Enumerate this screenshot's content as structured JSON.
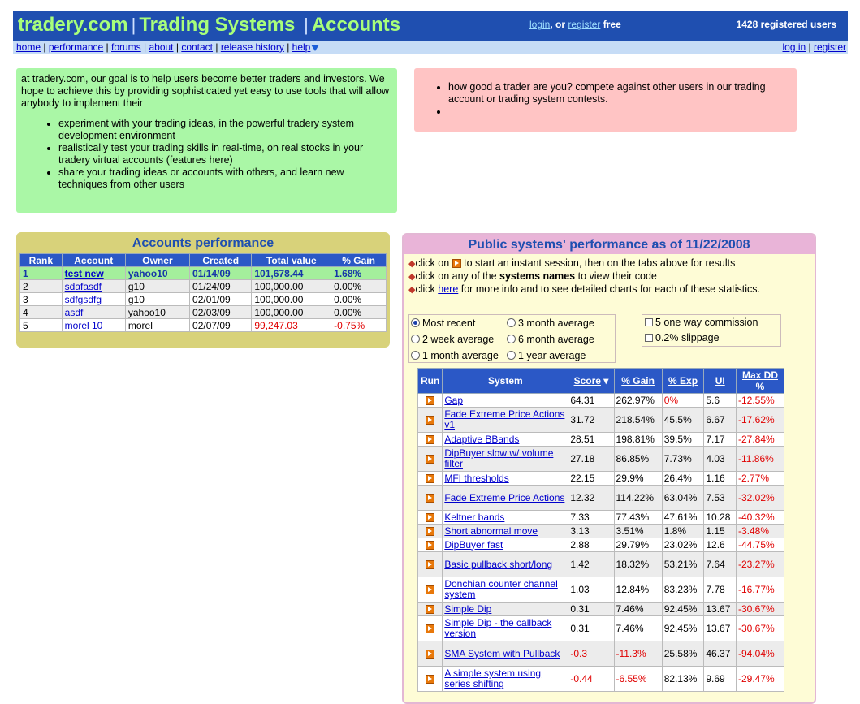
{
  "header": {
    "title_part1": "tradery.com",
    "title_part2": "Trading Systems",
    "title_part3": "Accounts",
    "login_label": "login",
    "or_label": ", or ",
    "register_label": "register",
    "free_label": " free",
    "users_count": "1428 registered users"
  },
  "nav": {
    "items": [
      "home",
      "performance",
      "forums",
      "about",
      "contact",
      "release history",
      "help"
    ],
    "login_label": "log in",
    "register_label": "register"
  },
  "intro": {
    "text": "at tradery.com, our goal is to help users become better traders and investors. We hope to achieve this by providing sophisticated yet easy to use tools that will allow anybody to implement their",
    "bullets": [
      "experiment with your trading ideas, in the powerful tradery system development environment",
      "realistically test your trading skills in real-time, on real stocks in your tradery virtual accounts (features here)",
      "share your trading ideas or accounts with others, and learn new techniques from other users"
    ]
  },
  "contest": {
    "bullets": [
      "how good a trader are you? compete against other users in our trading account or trading system contests.",
      ""
    ]
  },
  "accounts": {
    "title": "Accounts performance",
    "columns": [
      "Rank",
      "Account",
      "Owner",
      "Created",
      "Total value",
      "% Gain"
    ],
    "rows": [
      [
        "1",
        "test new",
        "yahoo10",
        "01/14/09",
        "101,678.44",
        "1.68%"
      ],
      [
        "2",
        "sdafasdf",
        "g10",
        "01/24/09",
        "100,000.00",
        "0.00%"
      ],
      [
        "3",
        "sdfgsdfg",
        "g10",
        "02/01/09",
        "100,000.00",
        "0.00%"
      ],
      [
        "4",
        "asdf",
        "yahoo10",
        "02/03/09",
        "100,000.00",
        "0.00%"
      ],
      [
        "5",
        "morel 10",
        "morel",
        "02/07/09",
        "99,247.03",
        "-0.75%"
      ]
    ]
  },
  "systems": {
    "title": "Public systems' performance as of 11/22/2008",
    "help": {
      "line1_pre": "click on ",
      "line1_post": " to start an instant session, then on the tabs above for results",
      "line2_pre": "click on any of the ",
      "line2_bold": "systems names",
      "line2_post": " to view their code",
      "line3_pre": "click ",
      "line3_link": "here",
      "line3_post": " for more info and to see detailed charts for each of these statistics."
    },
    "averages": [
      "Most recent",
      "3 month average",
      "2 week average",
      "6 month average",
      "1 month average",
      "1 year average"
    ],
    "selected_average": "Most recent",
    "commission_label": "5 one way commission",
    "slippage_label": "0.2% slippage",
    "columns": [
      "Run",
      "System",
      "Score",
      "% Gain",
      "% Exp",
      "UI",
      "Max DD %"
    ],
    "rows": [
      [
        "Gap",
        "64.31",
        "262.97%",
        "0%",
        "5.6",
        "-12.55%"
      ],
      [
        "Fade Extreme Price Actions v1",
        "31.72",
        "218.54%",
        "45.5%",
        "6.67",
        "-17.62%"
      ],
      [
        "Adaptive BBands",
        "28.51",
        "198.81%",
        "39.5%",
        "7.17",
        "-27.84%"
      ],
      [
        "DipBuyer slow w/ volume filter",
        "27.18",
        "86.85%",
        "7.73%",
        "4.03",
        "-11.86%"
      ],
      [
        "MFI thresholds",
        "22.15",
        "29.9%",
        "26.4%",
        "1.16",
        "-2.77%"
      ],
      [
        "Fade Extreme Price Actions",
        "12.32",
        "114.22%",
        "63.04%",
        "7.53",
        "-32.02%"
      ],
      [
        "Keltner bands",
        "7.33",
        "77.43%",
        "47.61%",
        "10.28",
        "-40.32%"
      ],
      [
        "Short abnormal move",
        "3.13",
        "3.51%",
        "1.8%",
        "1.15",
        "-3.48%"
      ],
      [
        "DipBuyer fast",
        "2.88",
        "29.79%",
        "23.02%",
        "12.6",
        "-44.75%"
      ],
      [
        "Basic pullback short/long",
        "1.42",
        "18.32%",
        "53.21%",
        "7.64",
        "-23.27%"
      ],
      [
        "Donchian counter channel system",
        "1.03",
        "12.84%",
        "83.23%",
        "7.78",
        "-16.77%"
      ],
      [
        "Simple Dip",
        "0.31",
        "7.46%",
        "92.45%",
        "13.67",
        "-30.67%"
      ],
      [
        "Simple Dip - the callback version",
        "0.31",
        "7.46%",
        "92.45%",
        "13.67",
        "-30.67%"
      ],
      [
        "SMA System with Pullback",
        "-0.3",
        "-11.3%",
        "25.58%",
        "46.37",
        "-94.04%"
      ],
      [
        "A simple system using series shifting",
        "-0.44",
        "-6.55%",
        "82.13%",
        "9.69",
        "-29.47%"
      ]
    ]
  }
}
